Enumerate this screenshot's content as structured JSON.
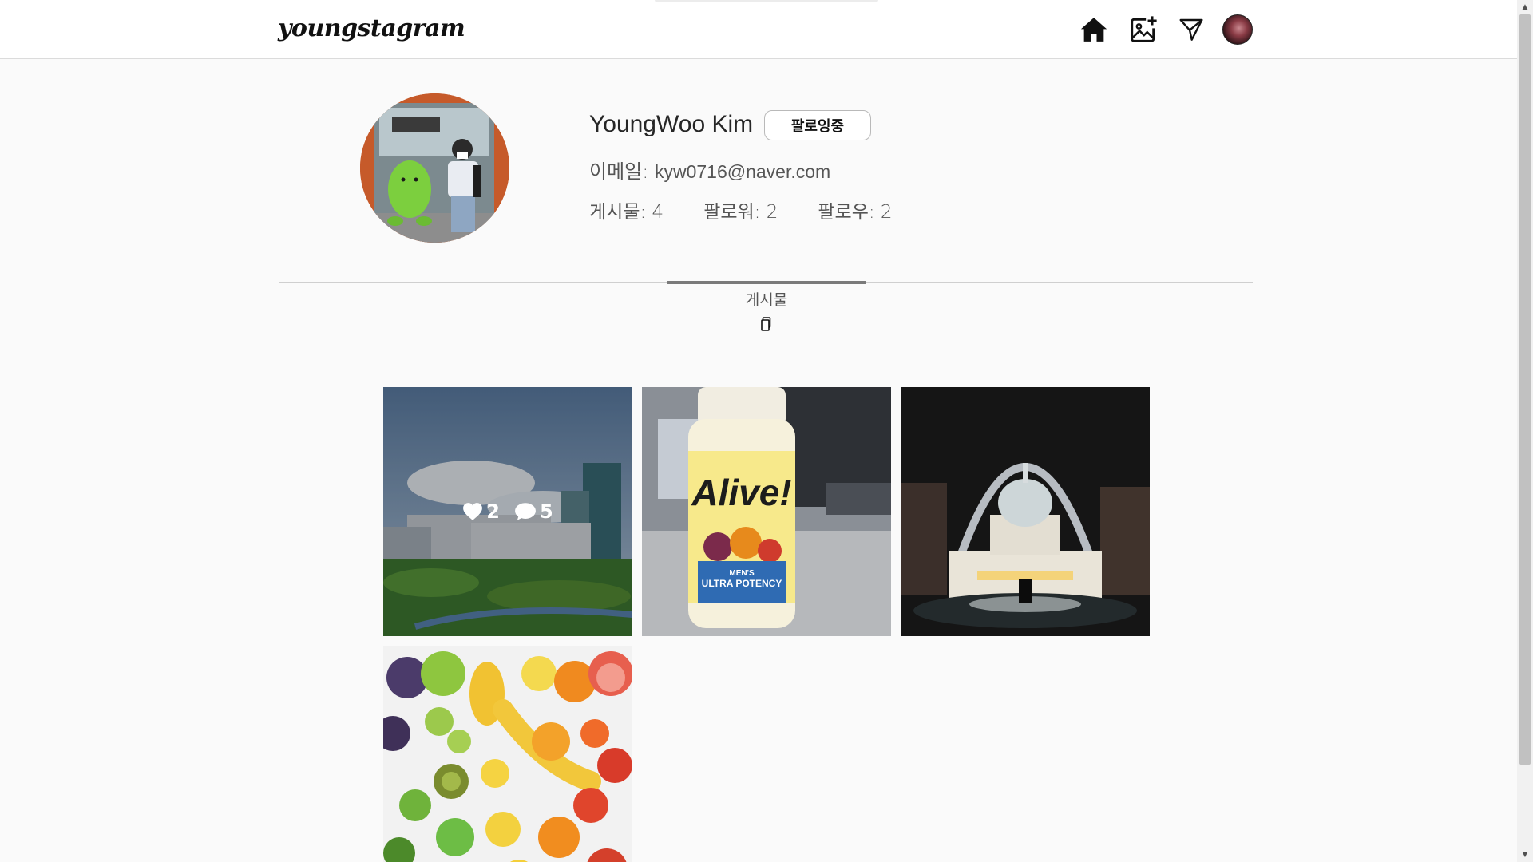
{
  "header": {
    "logo": "youngstagram",
    "icons": [
      "home-icon",
      "add-photo-icon",
      "send-icon",
      "profile-avatar"
    ]
  },
  "profile": {
    "name": "YoungWoo Kim",
    "follow_button": "팔로잉중",
    "email_label": "이메일: ",
    "email": "kyw0716@naver.com",
    "stats": {
      "posts": "게시물: 4",
      "followers": "팔로워: 2",
      "following": "팔로우: 2"
    }
  },
  "tabs": {
    "posts_label": "게시물"
  },
  "posts": [
    {
      "subject": "campus building landscape",
      "likes": "2",
      "comments": "5",
      "hovered": true
    },
    {
      "subject": "Alive! Men's Ultra Potency vitamin bottle",
      "bottle_text": {
        "brand": "Alive!",
        "line1": "MEN'S",
        "line2": "ULTRA POTENCY"
      }
    },
    {
      "subject": "night capitol dome with arch"
    },
    {
      "subject": "assorted colorful fruits"
    }
  ],
  "colors": {
    "background": "#fafafa",
    "header_bg": "#ffffff",
    "border": "#dbdbdb",
    "text": "#262626"
  }
}
